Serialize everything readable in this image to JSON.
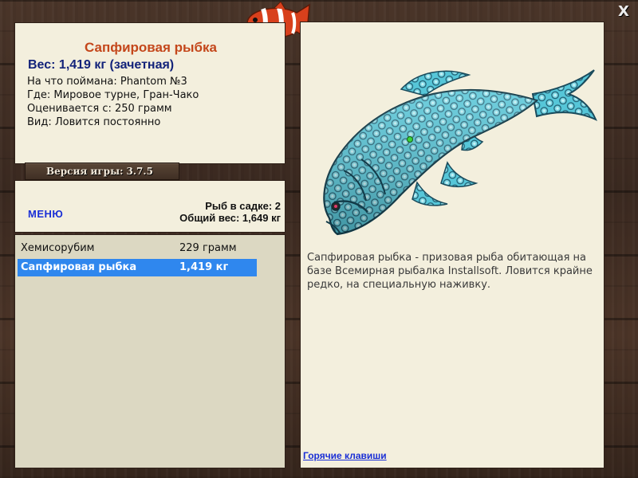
{
  "window": {
    "close_icon": "close-icon",
    "close_glyph": "X"
  },
  "logo": {
    "icon": "clownfish-logo-icon"
  },
  "info": {
    "title": "Сапфировая рыбка",
    "weight_line": "Вес: 1,419 кг (зачетная)",
    "lines": [
      "На что поймана: Phantom №3",
      "Где: Мировое турне, Гран-Чако",
      "Оценивается с: 250 грамм",
      "Вид: Ловится постоянно"
    ]
  },
  "version": {
    "label": "Версия игры:",
    "value": "3.7.5"
  },
  "stats": {
    "menu_label": "МЕНЮ",
    "count_line": "Рыб в садке: 2",
    "total_line": "Общий вес: 1,649 кг"
  },
  "catch_list": [
    {
      "name": "Хемисорубим",
      "weight": "229 грамм",
      "selected": false
    },
    {
      "name": "Сапфировая рыбка",
      "weight": "1,419 кг",
      "selected": true
    }
  ],
  "detail": {
    "image_icon": "sapphire-fish-illustration",
    "description": "Сапфировая рыбка - призовая рыба обитающая на базе Всемирная рыбалка Installsoft. Ловится крайне редко, на специальную наживку.",
    "hotkeys_label": "Горячие клавиши"
  },
  "colors": {
    "title": "#c4471b",
    "weight": "#13237a",
    "link": "#1a2fd6",
    "selection": "#2f87ee",
    "panel": "#f3efdd",
    "list_bg": "#dcd8c2",
    "fish_body": "#4ec3d6"
  }
}
